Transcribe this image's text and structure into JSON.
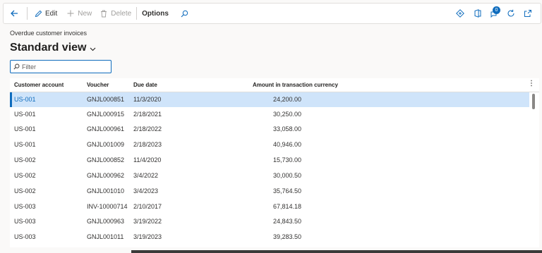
{
  "toolbar": {
    "back_icon": "back-arrow-icon",
    "edit_label": "Edit",
    "new_label": "New",
    "delete_label": "Delete",
    "options_label": "Options",
    "search_icon": "search-icon",
    "right_icons": [
      "diamond-icon",
      "office-icon",
      "notifications-icon",
      "refresh-icon",
      "open-new-window-icon"
    ],
    "notification_count": "0"
  },
  "page": {
    "caption": "Overdue customer invoices",
    "view_title": "Standard view"
  },
  "filter": {
    "placeholder": "Filter"
  },
  "grid": {
    "columns": [
      "Customer account",
      "Voucher",
      "Due date",
      "Amount in transaction currency"
    ],
    "rows": [
      {
        "account": "US-001",
        "voucher": "GNJL000851",
        "due": "11/3/2020",
        "amount": "24,200.00"
      },
      {
        "account": "US-001",
        "voucher": "GNJL000915",
        "due": "2/18/2021",
        "amount": "30,250.00"
      },
      {
        "account": "US-001",
        "voucher": "GNJL000961",
        "due": "2/18/2022",
        "amount": "33,058.00"
      },
      {
        "account": "US-001",
        "voucher": "GNJL001009",
        "due": "2/18/2023",
        "amount": "40,946.00"
      },
      {
        "account": "US-002",
        "voucher": "GNJL000852",
        "due": "11/4/2020",
        "amount": "15,730.00"
      },
      {
        "account": "US-002",
        "voucher": "GNJL000962",
        "due": "3/4/2022",
        "amount": "30,000.50"
      },
      {
        "account": "US-002",
        "voucher": "GNJL001010",
        "due": "3/4/2023",
        "amount": "35,764.50"
      },
      {
        "account": "US-003",
        "voucher": "INV-10000714",
        "due": "2/10/2017",
        "amount": "67,814.18"
      },
      {
        "account": "US-003",
        "voucher": "GNJL000963",
        "due": "3/19/2022",
        "amount": "24,843.50"
      },
      {
        "account": "US-003",
        "voucher": "GNJL001011",
        "due": "3/19/2023",
        "amount": "39,283.50"
      }
    ],
    "selected_row": 0
  },
  "colors": {
    "accent": "#0f6cbd",
    "selected_row": "#cfe4fa"
  }
}
